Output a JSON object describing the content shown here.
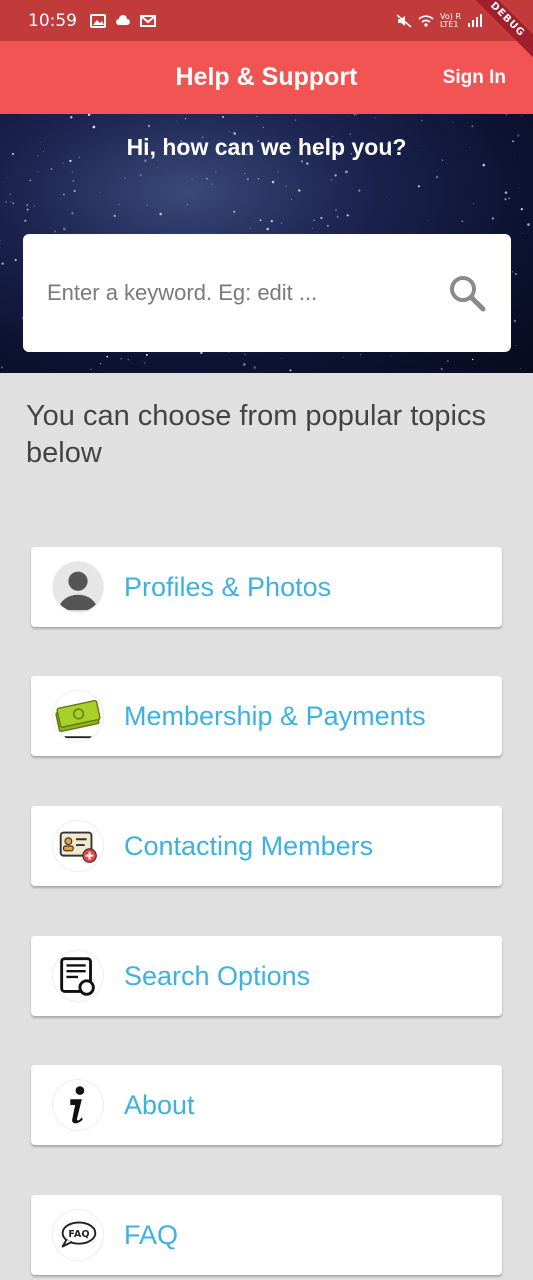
{
  "status_bar": {
    "time": "10:59",
    "net_top": "Vo) R",
    "net_bottom": "LTE1",
    "debug_label": "DEBUG"
  },
  "app_bar": {
    "title": "Help & Support",
    "sign_in_label": "Sign In"
  },
  "hero": {
    "title": "Hi, how can we help you?",
    "search_placeholder": "Enter a keyword. Eg: edit ..."
  },
  "intro_text": "You can choose from popular topics below",
  "topics": [
    {
      "label": "Profiles & Photos",
      "icon": "profile-icon"
    },
    {
      "label": "Membership & Payments",
      "icon": "money-icon"
    },
    {
      "label": "Contacting Members",
      "icon": "contact-card-icon"
    },
    {
      "label": "Search Options",
      "icon": "search-document-icon"
    },
    {
      "label": "About",
      "icon": "info-icon"
    },
    {
      "label": "FAQ",
      "icon": "faq-icon"
    }
  ],
  "colors": {
    "status_bar": "#c23b3b",
    "app_bar": "#f25454",
    "topic_text": "#3db1e0",
    "background": "#e0e0e0"
  }
}
